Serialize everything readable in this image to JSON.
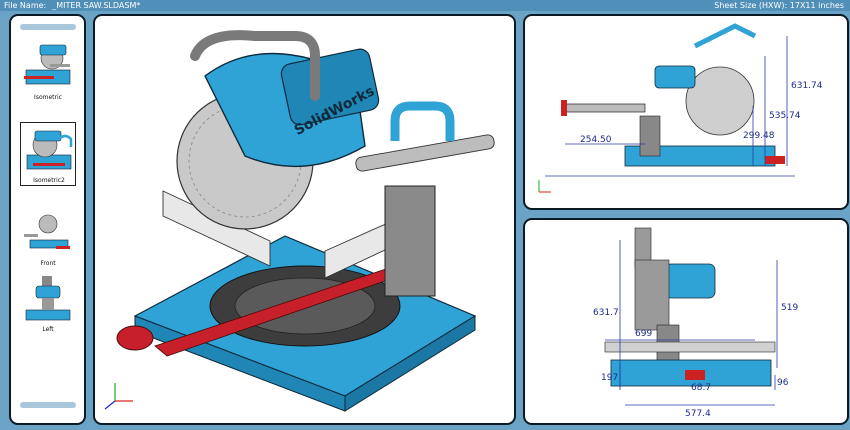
{
  "header": {
    "file_label": "File Name:",
    "file_name": "_MITER SAW.SLDASM*",
    "sheet_size": "Sheet Size (HXW):  17X11 inches"
  },
  "thumbnails": [
    {
      "label": "Isometric",
      "selected": false
    },
    {
      "label": "Isometric2",
      "selected": true
    },
    {
      "label": "Front",
      "selected": false
    },
    {
      "label": "Left",
      "selected": false
    }
  ],
  "main_view": {
    "brand_label": "SolidWorks"
  },
  "view_top_right": {
    "dims": [
      "631.74",
      "535.74",
      "299.48",
      "254.50"
    ]
  },
  "view_bottom_right": {
    "dims": [
      "631.7",
      "519",
      "699",
      "197",
      "96",
      "68.7",
      "577.4"
    ]
  },
  "colors": {
    "accent": "#2fa3d6",
    "frame": "#6aa3c6",
    "dimension": "#1c2a8a"
  }
}
